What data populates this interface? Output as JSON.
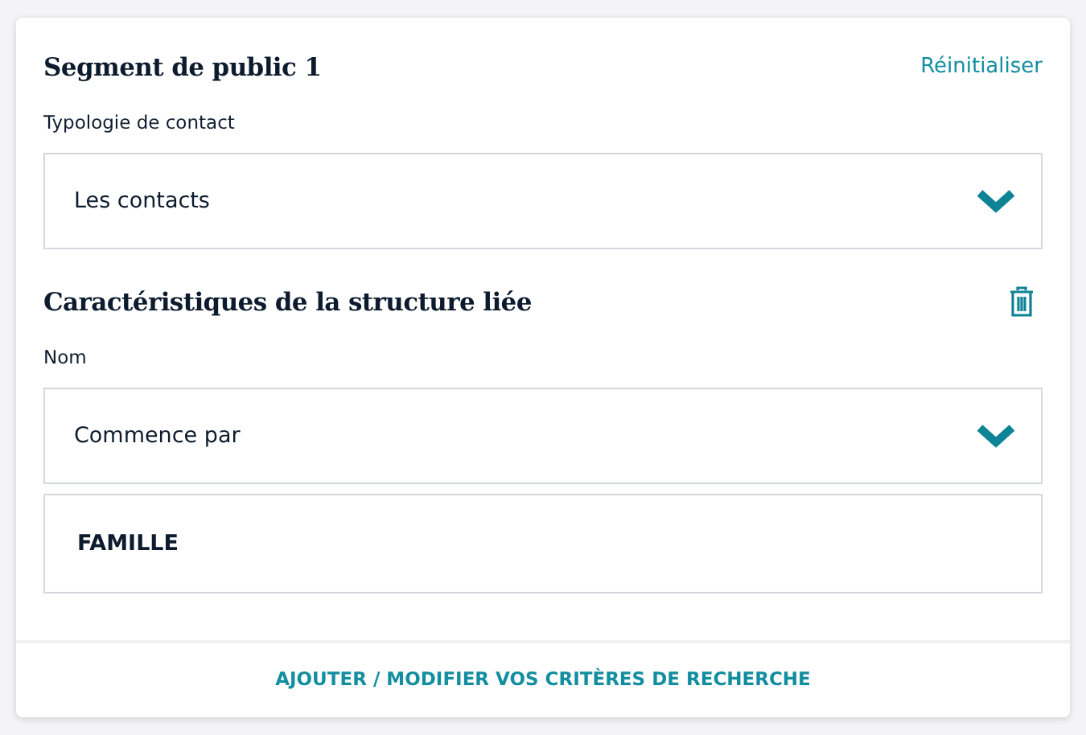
{
  "segment": {
    "title": "Segment de public 1",
    "reset_link": "Réinitialiser"
  },
  "contact_type": {
    "label": "Typologie de contact",
    "value": "Les contacts"
  },
  "section": {
    "title": "Caractéristiques de la structure liée",
    "deletable": true,
    "label": "Nom",
    "fields": [
      {
        "kind": "select",
        "value": "Commence par"
      },
      {
        "kind": "text",
        "value": "FAMILLE"
      }
    ]
  },
  "footer_link": "AJOUTER / MODIFIER VOS CRITÈRES DE RECHERCHE"
}
